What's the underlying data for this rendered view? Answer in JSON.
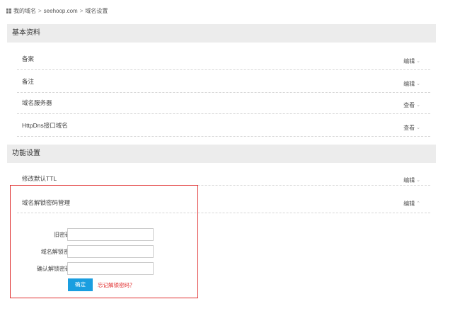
{
  "breadcrumb": {
    "items": [
      "我的域名",
      "seehoop.com",
      "域名设置"
    ],
    "separator": ">"
  },
  "basic": {
    "title": "基本资料",
    "rows": [
      {
        "label": "备案",
        "action": "编辑"
      },
      {
        "label": "备注",
        "action": "编辑"
      },
      {
        "label": "域名服务器",
        "action": "查看"
      },
      {
        "label": "HttpDns接口域名",
        "action": "查看"
      }
    ]
  },
  "features": {
    "title": "功能设置",
    "rows": [
      {
        "label": "修改默认TTL",
        "action": "编辑"
      },
      {
        "label": "域名解锁密码管理",
        "action": "编辑"
      }
    ]
  },
  "unlock_form": {
    "fields": [
      {
        "label": "旧密码：",
        "value": ""
      },
      {
        "label": "域名解锁密码:",
        "value": ""
      },
      {
        "label": "确认解锁密码：",
        "value": ""
      }
    ],
    "confirm_label": "确定",
    "forgot_label": "忘记解锁密码？"
  },
  "colors": {
    "accent": "#1a9ee0",
    "highlight": "#e03030",
    "link_red": "#e02b2b",
    "section_bg": "#ececec"
  },
  "icons": {
    "breadcrumb": "grid-icon",
    "collapsed": "chevron-double-down-icon",
    "expanded": "chevron-double-up-icon"
  }
}
